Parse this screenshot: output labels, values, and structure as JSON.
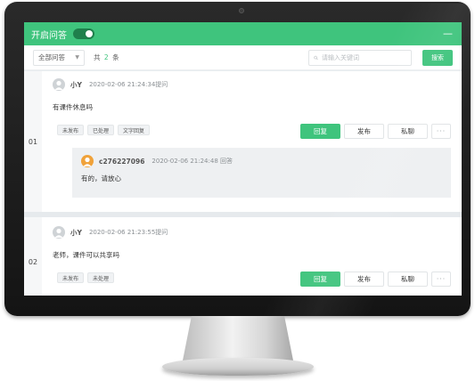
{
  "app": {
    "title": "开启问答",
    "toggle_on": true,
    "minimize_label": "—",
    "accent_color": "#3fc47d"
  },
  "filter": {
    "select_value": "全部问答",
    "total_prefix": "共",
    "total_count": "2",
    "total_suffix": "条",
    "search_placeholder": "请输入关键词",
    "search_button": "搜索"
  },
  "actions": {
    "reply": "回复",
    "publish": "发布",
    "private_chat": "私聊",
    "more": "···"
  },
  "questions": [
    {
      "index": "01",
      "user": "小Y",
      "time": "2020-02-06 21:24:34提问",
      "text": "有课件休息吗",
      "tags": [
        "未发布",
        "已处理",
        "文字回复"
      ],
      "answer": {
        "user": "c276227096",
        "time": "2020-02-06 21:24:48 回答",
        "text": "有的，请放心"
      }
    },
    {
      "index": "02",
      "user": "小Y",
      "time": "2020-02-06 21:23:55提问",
      "text": "老师，课件可以共享吗",
      "tags": [
        "未发布",
        "未处理"
      ]
    }
  ]
}
